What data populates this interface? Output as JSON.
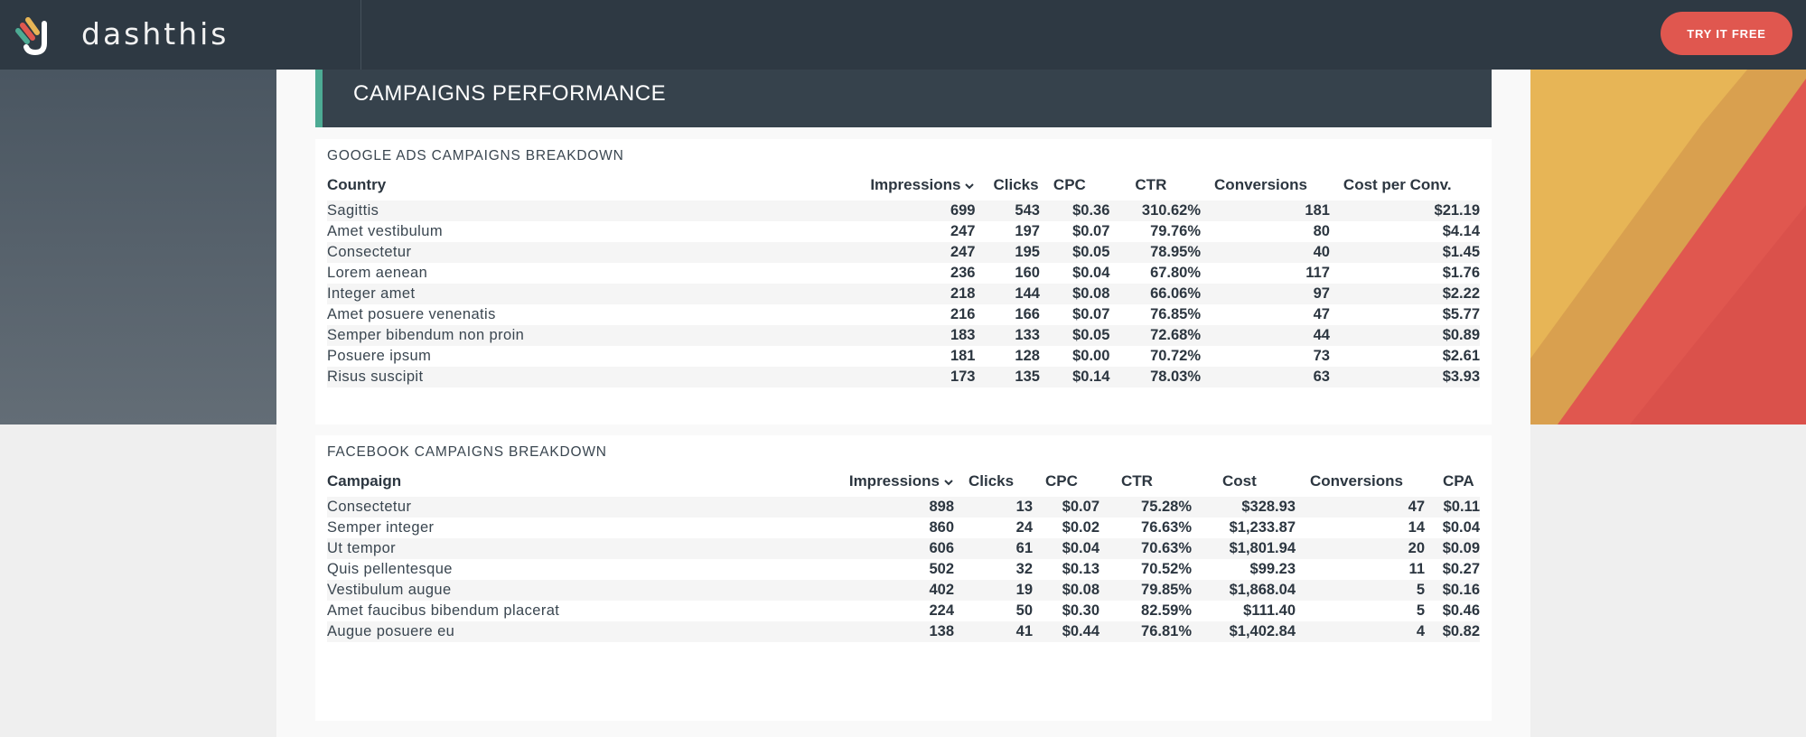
{
  "nav": {
    "brand": "dashthis",
    "cta_label": "TRY IT FREE"
  },
  "section": {
    "title": "CAMPAIGNS PERFORMANCE"
  },
  "google": {
    "title": "GOOGLE ADS CAMPAIGNS BREAKDOWN",
    "columns": [
      "Country",
      "Impressions",
      "Clicks",
      "CPC",
      "CTR",
      "Conversions",
      "Cost per Conv."
    ],
    "rows": [
      [
        "Sagittis",
        "699",
        "543",
        "$0.36",
        "310.62%",
        "181",
        "$21.19"
      ],
      [
        "Amet vestibulum",
        "247",
        "197",
        "$0.07",
        "79.76%",
        "80",
        "$4.14"
      ],
      [
        "Consectetur",
        "247",
        "195",
        "$0.05",
        "78.95%",
        "40",
        "$1.45"
      ],
      [
        "Lorem aenean",
        "236",
        "160",
        "$0.04",
        "67.80%",
        "117",
        "$1.76"
      ],
      [
        "Integer amet",
        "218",
        "144",
        "$0.08",
        "66.06%",
        "97",
        "$2.22"
      ],
      [
        "Amet posuere venenatis",
        "216",
        "166",
        "$0.07",
        "76.85%",
        "47",
        "$5.77"
      ],
      [
        "Semper bibendum non proin",
        "183",
        "133",
        "$0.05",
        "72.68%",
        "44",
        "$0.89"
      ],
      [
        "Posuere ipsum",
        "181",
        "128",
        "$0.00",
        "70.72%",
        "73",
        "$2.61"
      ],
      [
        "Risus suscipit",
        "173",
        "135",
        "$0.14",
        "78.03%",
        "63",
        "$3.93"
      ]
    ]
  },
  "facebook": {
    "title": "FACEBOOK CAMPAIGNS BREAKDOWN",
    "columns": [
      "Campaign",
      "Impressions",
      "Clicks",
      "CPC",
      "CTR",
      "Cost",
      "Conversions",
      "CPA"
    ],
    "rows": [
      [
        "Consectetur",
        "898",
        "13",
        "$0.07",
        "75.28%",
        "$328.93",
        "47",
        "$0.11"
      ],
      [
        "Semper integer",
        "860",
        "24",
        "$0.02",
        "76.63%",
        "$1,233.87",
        "14",
        "$0.04"
      ],
      [
        "Ut tempor",
        "606",
        "61",
        "$0.04",
        "70.63%",
        "$1,801.94",
        "20",
        "$0.09"
      ],
      [
        "Quis pellentesque",
        "502",
        "32",
        "$0.13",
        "70.52%",
        "$99.23",
        "11",
        "$0.27"
      ],
      [
        "Vestibulum augue",
        "402",
        "19",
        "$0.08",
        "79.85%",
        "$1,868.04",
        "5",
        "$0.16"
      ],
      [
        "Amet faucibus bibendum placerat",
        "224",
        "50",
        "$0.30",
        "82.59%",
        "$111.40",
        "5",
        "$0.46"
      ],
      [
        "Augue posuere eu",
        "138",
        "41",
        "$0.44",
        "76.81%",
        "$1,402.84",
        "4",
        "$0.82"
      ]
    ]
  },
  "icons": {
    "logo": "dashthis-logo-icon",
    "sort": "chevron-down-icon"
  },
  "colors": {
    "nav_bg": "#2e3943",
    "cta": "#e0574f",
    "header_bg": "#36424c",
    "accent": "#4dab94"
  }
}
